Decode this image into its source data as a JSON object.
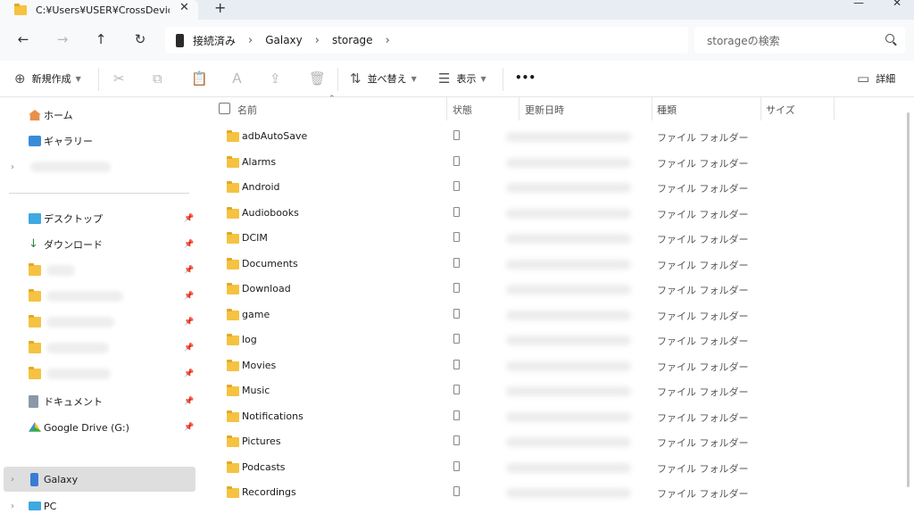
{
  "window": {
    "tab_title": "C:¥Users¥USER¥CrossDevice¥G",
    "tab_close": "✕",
    "new_tab": "+",
    "minimize": "—",
    "close": "✕"
  },
  "nav": {
    "back": "←",
    "forward": "→",
    "up": "↑",
    "refresh": "↻",
    "breadcrumbs": [
      "接続済み",
      "Galaxy",
      "storage"
    ],
    "separator": "›",
    "search_placeholder": "storageの検索"
  },
  "toolbar": {
    "new": "新規作成",
    "sort": "並べ替え",
    "view": "表示",
    "more": "•••",
    "details": "詳細",
    "icons": {
      "new": "⊕",
      "cut": "✂",
      "copy": "⧉",
      "paste": "📋",
      "rename": "Ａ",
      "share": "⇪",
      "delete": "🗑",
      "sort": "⇅",
      "view": "☰",
      "details": "▭"
    }
  },
  "sidebar": {
    "home": "ホーム",
    "gallery": "ギャラリー",
    "desktop": "デスクトップ",
    "downloads": "ダウンロード",
    "documents": "ドキュメント",
    "google_drive": "Google Drive (G:)",
    "galaxy": "Galaxy",
    "pc": "PC",
    "chevron": "›",
    "pin": "📌"
  },
  "columns": {
    "name": "名前",
    "status": "状態",
    "modified": "更新日時",
    "type": "種類",
    "size": "サイズ",
    "sort_indicator": "⌃"
  },
  "files": [
    {
      "name": "adbAutoSave",
      "type": "ファイル フォルダー"
    },
    {
      "name": "Alarms",
      "type": "ファイル フォルダー"
    },
    {
      "name": "Android",
      "type": "ファイル フォルダー"
    },
    {
      "name": "Audiobooks",
      "type": "ファイル フォルダー"
    },
    {
      "name": "DCIM",
      "type": "ファイル フォルダー"
    },
    {
      "name": "Documents",
      "type": "ファイル フォルダー"
    },
    {
      "name": "Download",
      "type": "ファイル フォルダー"
    },
    {
      "name": "game",
      "type": "ファイル フォルダー"
    },
    {
      "name": "log",
      "type": "ファイル フォルダー"
    },
    {
      "name": "Movies",
      "type": "ファイル フォルダー"
    },
    {
      "name": "Music",
      "type": "ファイル フォルダー"
    },
    {
      "name": "Notifications",
      "type": "ファイル フォルダー"
    },
    {
      "name": "Pictures",
      "type": "ファイル フォルダー"
    },
    {
      "name": "Podcasts",
      "type": "ファイル フォルダー"
    },
    {
      "name": "Recordings",
      "type": "ファイル フォルダー"
    }
  ],
  "colors": {
    "folder": "#f5c242",
    "selection": "#dedede",
    "accent": "#1a73e8"
  }
}
